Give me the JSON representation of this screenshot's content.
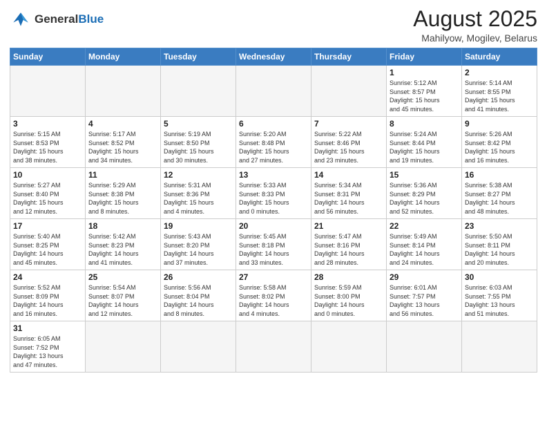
{
  "logo": {
    "text_general": "General",
    "text_blue": "Blue"
  },
  "header": {
    "title": "August 2025",
    "subtitle": "Mahilyow, Mogilev, Belarus"
  },
  "weekdays": [
    "Sunday",
    "Monday",
    "Tuesday",
    "Wednesday",
    "Thursday",
    "Friday",
    "Saturday"
  ],
  "weeks": [
    [
      {
        "day": "",
        "info": ""
      },
      {
        "day": "",
        "info": ""
      },
      {
        "day": "",
        "info": ""
      },
      {
        "day": "",
        "info": ""
      },
      {
        "day": "",
        "info": ""
      },
      {
        "day": "1",
        "info": "Sunrise: 5:12 AM\nSunset: 8:57 PM\nDaylight: 15 hours\nand 45 minutes."
      },
      {
        "day": "2",
        "info": "Sunrise: 5:14 AM\nSunset: 8:55 PM\nDaylight: 15 hours\nand 41 minutes."
      }
    ],
    [
      {
        "day": "3",
        "info": "Sunrise: 5:15 AM\nSunset: 8:53 PM\nDaylight: 15 hours\nand 38 minutes."
      },
      {
        "day": "4",
        "info": "Sunrise: 5:17 AM\nSunset: 8:52 PM\nDaylight: 15 hours\nand 34 minutes."
      },
      {
        "day": "5",
        "info": "Sunrise: 5:19 AM\nSunset: 8:50 PM\nDaylight: 15 hours\nand 30 minutes."
      },
      {
        "day": "6",
        "info": "Sunrise: 5:20 AM\nSunset: 8:48 PM\nDaylight: 15 hours\nand 27 minutes."
      },
      {
        "day": "7",
        "info": "Sunrise: 5:22 AM\nSunset: 8:46 PM\nDaylight: 15 hours\nand 23 minutes."
      },
      {
        "day": "8",
        "info": "Sunrise: 5:24 AM\nSunset: 8:44 PM\nDaylight: 15 hours\nand 19 minutes."
      },
      {
        "day": "9",
        "info": "Sunrise: 5:26 AM\nSunset: 8:42 PM\nDaylight: 15 hours\nand 16 minutes."
      }
    ],
    [
      {
        "day": "10",
        "info": "Sunrise: 5:27 AM\nSunset: 8:40 PM\nDaylight: 15 hours\nand 12 minutes."
      },
      {
        "day": "11",
        "info": "Sunrise: 5:29 AM\nSunset: 8:38 PM\nDaylight: 15 hours\nand 8 minutes."
      },
      {
        "day": "12",
        "info": "Sunrise: 5:31 AM\nSunset: 8:36 PM\nDaylight: 15 hours\nand 4 minutes."
      },
      {
        "day": "13",
        "info": "Sunrise: 5:33 AM\nSunset: 8:33 PM\nDaylight: 15 hours\nand 0 minutes."
      },
      {
        "day": "14",
        "info": "Sunrise: 5:34 AM\nSunset: 8:31 PM\nDaylight: 14 hours\nand 56 minutes."
      },
      {
        "day": "15",
        "info": "Sunrise: 5:36 AM\nSunset: 8:29 PM\nDaylight: 14 hours\nand 52 minutes."
      },
      {
        "day": "16",
        "info": "Sunrise: 5:38 AM\nSunset: 8:27 PM\nDaylight: 14 hours\nand 48 minutes."
      }
    ],
    [
      {
        "day": "17",
        "info": "Sunrise: 5:40 AM\nSunset: 8:25 PM\nDaylight: 14 hours\nand 45 minutes."
      },
      {
        "day": "18",
        "info": "Sunrise: 5:42 AM\nSunset: 8:23 PM\nDaylight: 14 hours\nand 41 minutes."
      },
      {
        "day": "19",
        "info": "Sunrise: 5:43 AM\nSunset: 8:20 PM\nDaylight: 14 hours\nand 37 minutes."
      },
      {
        "day": "20",
        "info": "Sunrise: 5:45 AM\nSunset: 8:18 PM\nDaylight: 14 hours\nand 33 minutes."
      },
      {
        "day": "21",
        "info": "Sunrise: 5:47 AM\nSunset: 8:16 PM\nDaylight: 14 hours\nand 28 minutes."
      },
      {
        "day": "22",
        "info": "Sunrise: 5:49 AM\nSunset: 8:14 PM\nDaylight: 14 hours\nand 24 minutes."
      },
      {
        "day": "23",
        "info": "Sunrise: 5:50 AM\nSunset: 8:11 PM\nDaylight: 14 hours\nand 20 minutes."
      }
    ],
    [
      {
        "day": "24",
        "info": "Sunrise: 5:52 AM\nSunset: 8:09 PM\nDaylight: 14 hours\nand 16 minutes."
      },
      {
        "day": "25",
        "info": "Sunrise: 5:54 AM\nSunset: 8:07 PM\nDaylight: 14 hours\nand 12 minutes."
      },
      {
        "day": "26",
        "info": "Sunrise: 5:56 AM\nSunset: 8:04 PM\nDaylight: 14 hours\nand 8 minutes."
      },
      {
        "day": "27",
        "info": "Sunrise: 5:58 AM\nSunset: 8:02 PM\nDaylight: 14 hours\nand 4 minutes."
      },
      {
        "day": "28",
        "info": "Sunrise: 5:59 AM\nSunset: 8:00 PM\nDaylight: 14 hours\nand 0 minutes."
      },
      {
        "day": "29",
        "info": "Sunrise: 6:01 AM\nSunset: 7:57 PM\nDaylight: 13 hours\nand 56 minutes."
      },
      {
        "day": "30",
        "info": "Sunrise: 6:03 AM\nSunset: 7:55 PM\nDaylight: 13 hours\nand 51 minutes."
      }
    ],
    [
      {
        "day": "31",
        "info": "Sunrise: 6:05 AM\nSunset: 7:52 PM\nDaylight: 13 hours\nand 47 minutes."
      },
      {
        "day": "",
        "info": ""
      },
      {
        "day": "",
        "info": ""
      },
      {
        "day": "",
        "info": ""
      },
      {
        "day": "",
        "info": ""
      },
      {
        "day": "",
        "info": ""
      },
      {
        "day": "",
        "info": ""
      }
    ]
  ]
}
